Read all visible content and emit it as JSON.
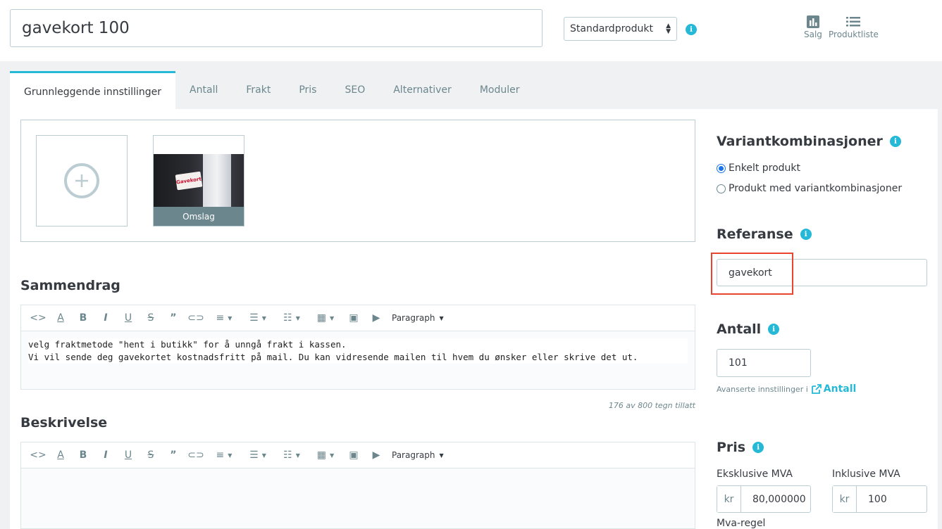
{
  "header": {
    "product_name": "gavekort 100",
    "product_type": "Standardprodukt",
    "info_glyph": "i",
    "sales_label": "Salg",
    "product_list_label": "Produktliste"
  },
  "tabs": [
    {
      "label": "Grunnleggende innstillinger",
      "active": true
    },
    {
      "label": "Antall"
    },
    {
      "label": "Frakt"
    },
    {
      "label": "Pris"
    },
    {
      "label": "SEO"
    },
    {
      "label": "Alternativer"
    },
    {
      "label": "Moduler"
    }
  ],
  "images": {
    "cover_caption": "Omslag",
    "card_text": "Gavekort"
  },
  "summary": {
    "title": "Sammendrag",
    "format_label": "Paragraph",
    "text": "velg fraktmetode \"hent i butikk\" for å unngå frakt i kassen.\nVi vil sende deg gavekortet kostnadsfritt på mail. Du kan vidresende mailen til hvem du ønsker eller skrive det ut.",
    "counter": "176 av 800 tegn tillatt"
  },
  "description": {
    "title": "Beskrivelse",
    "format_label": "Paragraph"
  },
  "combinations": {
    "title": "Variantkombinasjoner",
    "options": [
      "Enkelt produkt",
      "Produkt med variantkombinasjoner"
    ],
    "selected_index": 0
  },
  "reference": {
    "title": "Referanse",
    "value": "gavekort"
  },
  "quantity": {
    "title": "Antall",
    "value": "101",
    "advanced_text": "Avanserte innstillinger i",
    "advanced_link": "Antall"
  },
  "price": {
    "title": "Pris",
    "excl_label": "Eksklusive MVA",
    "incl_label": "Inklusive MVA",
    "currency": "kr",
    "excl_value": "80,000000",
    "incl_value": "100",
    "tax_rule_label": "Mva-regel"
  },
  "colors": {
    "accent": "#25b9d7",
    "highlight": "#e8452c"
  }
}
